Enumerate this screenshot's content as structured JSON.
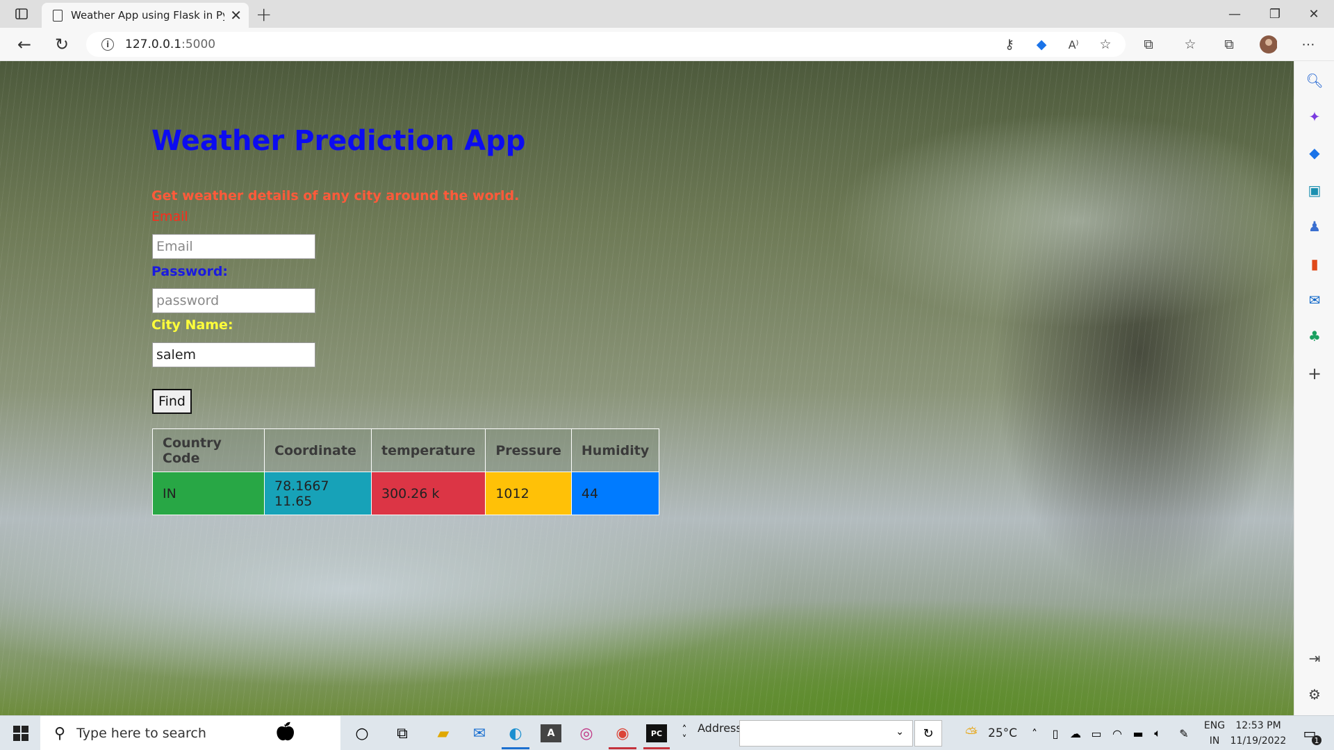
{
  "browser": {
    "tab_title": "Weather App using Flask in Pytho",
    "url_host": "127.0.0.1",
    "url_port": ":5000"
  },
  "page": {
    "title": "Weather Prediction App",
    "subtitle": "Get weather details of any city around the world.",
    "email_label": "Email",
    "email_placeholder": "Email",
    "password_label": "Password:",
    "password_placeholder": "password",
    "city_label": "City Name:",
    "city_value": "salem",
    "find_label": "Find",
    "table": {
      "headers": [
        "Country Code",
        "Coordinate",
        "temperature",
        "Pressure",
        "Humidity"
      ],
      "row": [
        "IN",
        "78.1667 11.65",
        "300.26 k",
        "1012",
        "44"
      ]
    }
  },
  "colors": {
    "title": "#0c0cf0",
    "subtitle": "#ff5a3a",
    "email_label": "#ff2a1a",
    "password_label": "#1a1ae0",
    "city_label": "#ffff3a",
    "cell_country": "#28a745",
    "cell_coord": "#17a2b8",
    "cell_temp": "#dc3545",
    "cell_pressure": "#ffc107",
    "cell_humidity": "#007bff"
  },
  "taskbar": {
    "search_placeholder": "Type here to search",
    "address_label": "Address",
    "weather": "25°C",
    "lang_1": "ENG",
    "lang_2": "IN",
    "time": "12:53 PM",
    "date": "11/19/2022",
    "notif_count": "1"
  }
}
